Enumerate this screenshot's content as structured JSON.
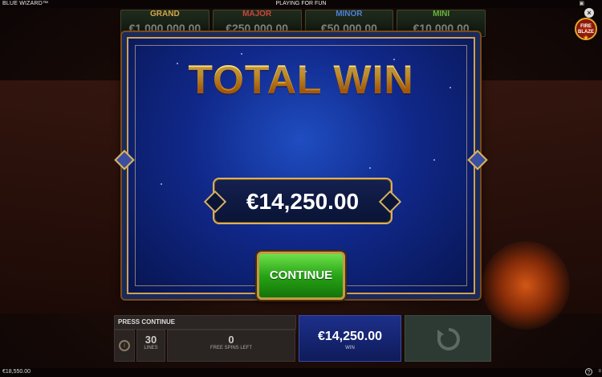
{
  "header": {
    "game_title": "BLUE WIZARD™",
    "mode_label": "PLAYING FOR FUN",
    "close_label": "×",
    "brand_icon": "brand-logo-icon",
    "badge": {
      "line1": "FIRE",
      "line2": "BLAZE",
      "star": "★"
    }
  },
  "jackpots": [
    {
      "label": "GRAND",
      "value": "€1,000,000.00",
      "color": "#d4a74a"
    },
    {
      "label": "MAJOR",
      "value": "€250,000.00",
      "color": "#c9473a"
    },
    {
      "label": "MINOR",
      "value": "€50,000.00",
      "color": "#4e7fd6"
    },
    {
      "label": "MINI",
      "value": "€10,000.00",
      "color": "#6ab43c"
    }
  ],
  "dialog": {
    "title": "TOTAL WIN",
    "amount": "€14,250.00",
    "continue_label": "CONTINUE"
  },
  "panel": {
    "press_continue": "PRESS CONTINUE",
    "lines_value": "30",
    "lines_label": "LINES",
    "free_spins_value": "0",
    "free_spins_label": "FREE SPINS LEFT",
    "win_value": "€14,250.00",
    "win_label": "WIN"
  },
  "footer": {
    "balance": "€18,550.00",
    "help_label": "?"
  },
  "colors": {
    "accent_gold": "#f6b81a",
    "dialog_blue": "#10288a",
    "continue_green": "#27a416"
  }
}
